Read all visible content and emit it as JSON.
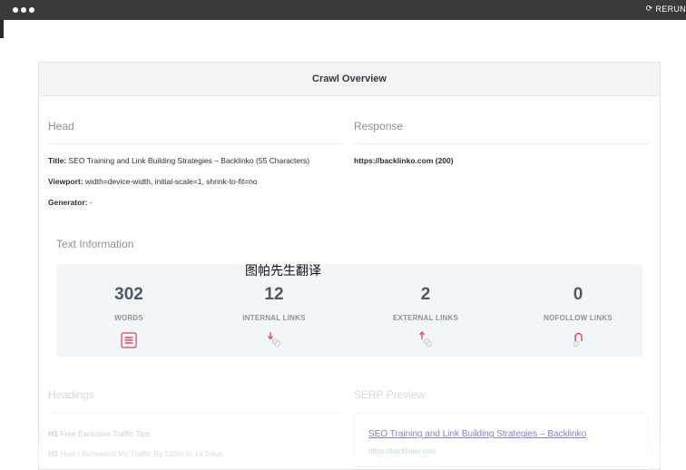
{
  "toolbar": {
    "rerun_label": "RERUN"
  },
  "panel": {
    "title": "Crawl Overview"
  },
  "head": {
    "title": "Head",
    "items": [
      {
        "label": "Title:",
        "value": "SEO Training and Link Building Strategies – Backlinko (55 Characters)"
      },
      {
        "label": "Viewport:",
        "value": "width=device-width, initial-scale=1, shrink-to-fit=no"
      },
      {
        "label": "Generator:",
        "value": "-"
      }
    ]
  },
  "response": {
    "title": "Response",
    "value": "https://backlinko.com (200)"
  },
  "text_info": {
    "title": "Text Information",
    "stats": [
      {
        "value": "302",
        "label": "WORDS",
        "icon": "list-icon"
      },
      {
        "value": "12",
        "label": "INTERNAL LINKS",
        "icon": "internal-link-icon"
      },
      {
        "value": "2",
        "label": "EXTERNAL LINKS",
        "icon": "external-link-icon"
      },
      {
        "value": "0",
        "label": "NOFOLLOW LINKS",
        "icon": "nofollow-link-icon"
      }
    ]
  },
  "overlay_text": "图帕先生翻译",
  "headings": {
    "title": "Headings",
    "items": [
      {
        "tag": "H1",
        "text": "Free Exclusive Traffic Tips"
      },
      {
        "tag": "H3",
        "text": "How I Increased My Traffic By 110% In 14 Days"
      }
    ]
  },
  "serp": {
    "title": "SERP Preview",
    "link": "SEO Training and Link Building Strategies – Backlinko",
    "url": "https://backlinko.com"
  },
  "colors": {
    "accent_red": "#e0405a",
    "link_blue": "#1a0dab",
    "url_green": "#006621"
  }
}
